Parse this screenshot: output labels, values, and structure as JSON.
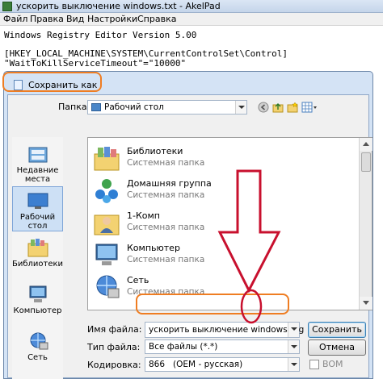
{
  "window": {
    "title": "ускорить выключение windows.txt - AkelPad",
    "menu": [
      "Файл",
      "Правка",
      "Вид",
      "Настройки",
      "Справка"
    ]
  },
  "editor": {
    "lines": [
      "Windows Registry Editor Version 5.00",
      "",
      "[HKEY_LOCAL_MACHINE\\SYSTEM\\CurrentControlSet\\Control]",
      "\"WaitToKillServiceTimeout\"=\"10000\""
    ]
  },
  "dialog": {
    "title": "Сохранить как",
    "folder_label": "Папка:",
    "folder_value": "Рабочий стол",
    "places": [
      {
        "label": "Недавние места",
        "icon": "recent-places-icon"
      },
      {
        "label": "Рабочий стол",
        "icon": "desktop-icon"
      },
      {
        "label": "Библиотеки",
        "icon": "libraries-icon"
      },
      {
        "label": "Компьютер",
        "icon": "computer-icon"
      },
      {
        "label": "Сеть",
        "icon": "network-icon"
      }
    ],
    "files": [
      {
        "name": "Библиотеки",
        "type": "Системная папка",
        "icon": "libraries-icon"
      },
      {
        "name": "Домашняя группа",
        "type": "Системная папка",
        "icon": "homegroup-icon"
      },
      {
        "name": "1-Комп",
        "type": "Системная папка",
        "icon": "user-folder-icon"
      },
      {
        "name": "Компьютер",
        "type": "Системная папка",
        "icon": "computer-icon"
      },
      {
        "name": "Сеть",
        "type": "Системная папка",
        "icon": "network-icon"
      }
    ],
    "filename_label": "Имя файла:",
    "filename_value": "ускорить выключение windows.reg",
    "filetype_label": "Тип файла:",
    "filetype_value": "Все файлы (*.*)",
    "encoding_label": "Кодировка:",
    "encoding_value": "866   (OEM - русская)",
    "bom_label": "BOM",
    "save_label": "Сохранить",
    "cancel_label": "Отмена"
  },
  "colors": {
    "highlight": "#ef7d22",
    "arrow": "#c8102e",
    "selection": "#cde0f5"
  }
}
